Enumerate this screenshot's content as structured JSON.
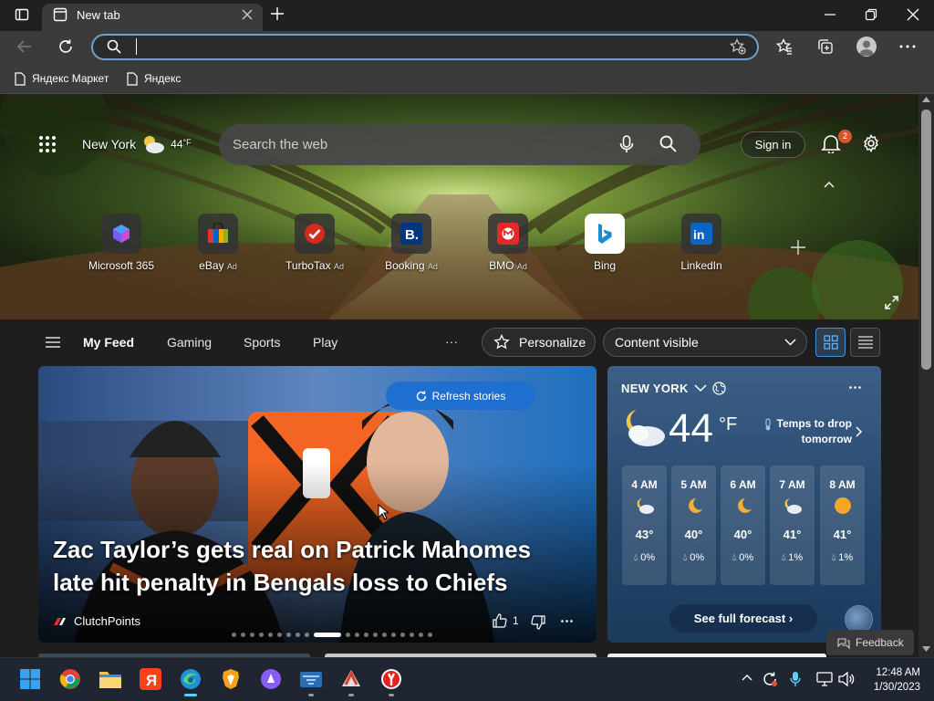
{
  "browser": {
    "tab_title": "New tab",
    "bookmarks": [
      "Яндекс Маркет",
      "Яндекс"
    ]
  },
  "header": {
    "location": "New York",
    "temp": "44",
    "temp_unit": "°F",
    "search_placeholder": "Search the web",
    "sign_in": "Sign in",
    "notifications": "2"
  },
  "quick_links": [
    {
      "label": "Microsoft 365",
      "ad": ""
    },
    {
      "label": "eBay",
      "ad": "Ad"
    },
    {
      "label": "TurboTax",
      "ad": "Ad"
    },
    {
      "label": "Booking",
      "ad": "Ad"
    },
    {
      "label": "BMO",
      "ad": "Ad"
    },
    {
      "label": "Bing",
      "ad": ""
    },
    {
      "label": "LinkedIn",
      "ad": ""
    }
  ],
  "feed_nav": {
    "tabs": [
      "My Feed",
      "Gaming",
      "Sports",
      "Play"
    ],
    "more": "···",
    "personalize": "Personalize",
    "content_visible": "Content visible"
  },
  "hero_story": {
    "refresh": "Refresh stories",
    "headline_line1": "Zac Taylor’s gets real on Patrick Mahomes",
    "headline_line2": "late hit penalty in Bengals loss to Chiefs",
    "source": "ClutchPoints",
    "likes": "1",
    "active_page_index": 9,
    "page_count": 20
  },
  "weather": {
    "city": "NEW YORK",
    "temp": "44",
    "unit": "°F",
    "note": "Temps to drop tomorrow",
    "hours": [
      {
        "time": "4 AM",
        "icon": "partly-cloudy-night-icon",
        "temp": "43°",
        "precip": "0%"
      },
      {
        "time": "5 AM",
        "icon": "moon-icon",
        "temp": "40°",
        "precip": "0%"
      },
      {
        "time": "6 AM",
        "icon": "moon-icon",
        "temp": "40°",
        "precip": "0%"
      },
      {
        "time": "7 AM",
        "icon": "partly-cloudy-night-icon",
        "temp": "41°",
        "precip": "1%"
      },
      {
        "time": "8 AM",
        "icon": "sun-icon",
        "temp": "41°",
        "precip": "1%"
      }
    ],
    "forecast_button": "See full forecast",
    "feedback": "Feedback"
  },
  "taskbar": {
    "time": "12:48 AM",
    "date": "1/30/2023"
  }
}
